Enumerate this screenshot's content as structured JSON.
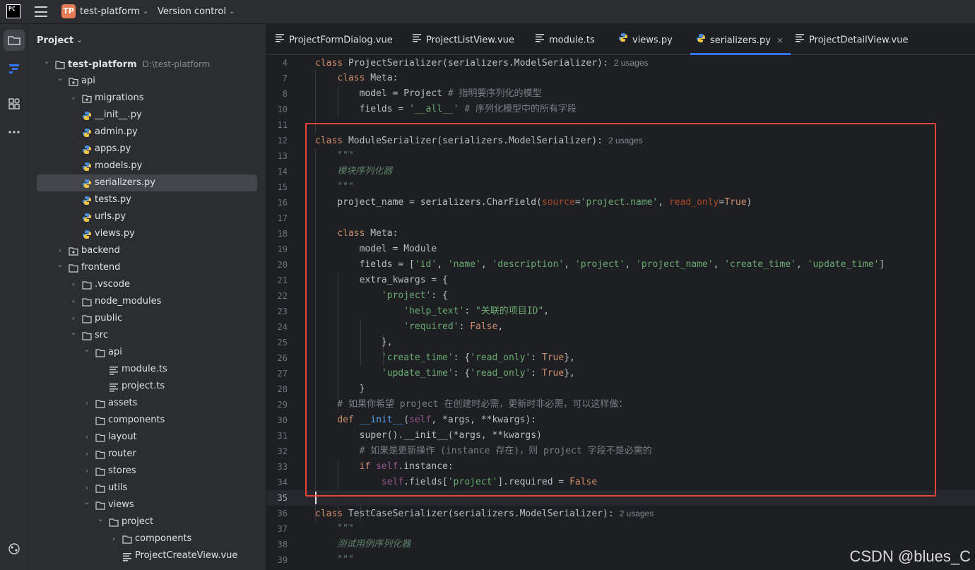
{
  "titlebar": {
    "logo_text": "PC",
    "project_badge": "TP",
    "project_name": "test-platform",
    "vcs_label": "Version control"
  },
  "toolstrip": {
    "icons": [
      "folder-icon",
      "structure-icon",
      "plugins-icon",
      "more-icon",
      "git-icon"
    ]
  },
  "project_panel": {
    "title": "Project",
    "tree": [
      {
        "label": "test-platform",
        "path": "D:\\test-platform",
        "depth": 0,
        "type": "folder",
        "expanded": true,
        "bold": true
      },
      {
        "label": "api",
        "depth": 1,
        "type": "package",
        "expanded": true
      },
      {
        "label": "migrations",
        "depth": 2,
        "type": "package",
        "expanded": false
      },
      {
        "label": "__init__.py",
        "depth": 2,
        "type": "python"
      },
      {
        "label": "admin.py",
        "depth": 2,
        "type": "python"
      },
      {
        "label": "apps.py",
        "depth": 2,
        "type": "python"
      },
      {
        "label": "models.py",
        "depth": 2,
        "type": "python"
      },
      {
        "label": "serializers.py",
        "depth": 2,
        "type": "python",
        "selected": true
      },
      {
        "label": "tests.py",
        "depth": 2,
        "type": "python"
      },
      {
        "label": "urls.py",
        "depth": 2,
        "type": "python"
      },
      {
        "label": "views.py",
        "depth": 2,
        "type": "python"
      },
      {
        "label": "backend",
        "depth": 1,
        "type": "package",
        "expanded": false
      },
      {
        "label": "frontend",
        "depth": 1,
        "type": "folder",
        "expanded": true
      },
      {
        "label": ".vscode",
        "depth": 2,
        "type": "folder",
        "expanded": false
      },
      {
        "label": "node_modules",
        "depth": 2,
        "type": "folder",
        "expanded": false
      },
      {
        "label": "public",
        "depth": 2,
        "type": "folder",
        "expanded": false
      },
      {
        "label": "src",
        "depth": 2,
        "type": "folder",
        "expanded": true
      },
      {
        "label": "api",
        "depth": 3,
        "type": "folder",
        "expanded": true
      },
      {
        "label": "module.ts",
        "depth": 4,
        "type": "text"
      },
      {
        "label": "project.ts",
        "depth": 4,
        "type": "text"
      },
      {
        "label": "assets",
        "depth": 3,
        "type": "folder",
        "expanded": false
      },
      {
        "label": "components",
        "depth": 3,
        "type": "folder",
        "leaf": true
      },
      {
        "label": "layout",
        "depth": 3,
        "type": "folder",
        "expanded": false
      },
      {
        "label": "router",
        "depth": 3,
        "type": "folder",
        "expanded": false
      },
      {
        "label": "stores",
        "depth": 3,
        "type": "folder",
        "expanded": false
      },
      {
        "label": "utils",
        "depth": 3,
        "type": "folder",
        "expanded": false
      },
      {
        "label": "views",
        "depth": 3,
        "type": "folder",
        "expanded": true
      },
      {
        "label": "project",
        "depth": 4,
        "type": "folder",
        "expanded": true
      },
      {
        "label": "components",
        "depth": 5,
        "type": "folder",
        "expanded": false
      },
      {
        "label": "ProjectCreateView.vue",
        "depth": 5,
        "type": "text"
      }
    ]
  },
  "tabs": [
    {
      "label": "ProjectFormDialog.vue",
      "type": "text"
    },
    {
      "label": "ProjectListView.vue",
      "type": "text"
    },
    {
      "label": "module.ts",
      "type": "text"
    },
    {
      "label": "views.py",
      "type": "python"
    },
    {
      "label": "serializers.py",
      "type": "python",
      "active": true,
      "close": "×"
    },
    {
      "label": "ProjectDetailView.vue",
      "type": "text"
    }
  ],
  "code": {
    "current_line": "35",
    "lines": [
      {
        "n": "4",
        "tokens": [
          [
            "kw",
            "class "
          ],
          [
            "",
            "ProjectSerializer(serializers.ModelSerializer):"
          ]
        ],
        "usage": "2 usages"
      },
      {
        "n": "7",
        "tokens": [
          [
            "",
            "    "
          ],
          [
            "kw",
            "class "
          ],
          [
            "",
            "Meta:"
          ]
        ]
      },
      {
        "n": "8",
        "tokens": [
          [
            "",
            "        model = Project "
          ],
          [
            "cm",
            "# 指明要序列化的模型"
          ]
        ]
      },
      {
        "n": "10",
        "tokens": [
          [
            "",
            "        fields = "
          ],
          [
            "str",
            "'__all__'"
          ],
          [
            "cm",
            " # 序列化模型中的所有字段"
          ]
        ]
      },
      {
        "n": "11",
        "tokens": []
      },
      {
        "n": "12",
        "tokens": [
          [
            "kw",
            "class "
          ],
          [
            "",
            "ModuleSerializer(serializers.ModelSerializer):"
          ]
        ],
        "usage": "2 usages"
      },
      {
        "n": "13",
        "tokens": [
          [
            "doc",
            "    \"\"\""
          ]
        ]
      },
      {
        "n": "14",
        "tokens": [
          [
            "docit",
            "    模块序列化器"
          ]
        ]
      },
      {
        "n": "15",
        "tokens": [
          [
            "doc",
            "    \"\"\""
          ]
        ]
      },
      {
        "n": "16",
        "tokens": [
          [
            "",
            "    project_name = serializers.CharField("
          ],
          [
            "prm",
            "source"
          ],
          [
            "",
            "="
          ],
          [
            "str",
            "'project.name'"
          ],
          [
            "",
            ", "
          ],
          [
            "prm",
            "read_only"
          ],
          [
            "",
            "="
          ],
          [
            "kw",
            "True"
          ],
          [
            "",
            ")"
          ]
        ]
      },
      {
        "n": "17",
        "tokens": []
      },
      {
        "n": "18",
        "tokens": [
          [
            "",
            "    "
          ],
          [
            "kw",
            "class "
          ],
          [
            "",
            "Meta:"
          ]
        ]
      },
      {
        "n": "19",
        "tokens": [
          [
            "",
            "        model = Module"
          ]
        ]
      },
      {
        "n": "20",
        "tokens": [
          [
            "",
            "        fields = ["
          ],
          [
            "str",
            "'id'"
          ],
          [
            "",
            ", "
          ],
          [
            "str",
            "'name'"
          ],
          [
            "",
            ", "
          ],
          [
            "str",
            "'description'"
          ],
          [
            "",
            ", "
          ],
          [
            "str",
            "'project'"
          ],
          [
            "",
            ", "
          ],
          [
            "str",
            "'project_name'"
          ],
          [
            "",
            ", "
          ],
          [
            "str",
            "'create_time'"
          ],
          [
            "",
            ", "
          ],
          [
            "str",
            "'update_time'"
          ],
          [
            "",
            "]"
          ]
        ]
      },
      {
        "n": "21",
        "tokens": [
          [
            "",
            "        extra_kwargs = {"
          ]
        ]
      },
      {
        "n": "22",
        "tokens": [
          [
            "",
            "            "
          ],
          [
            "str",
            "'project'"
          ],
          [
            "",
            ": {"
          ]
        ]
      },
      {
        "n": "23",
        "tokens": [
          [
            "",
            "                "
          ],
          [
            "str",
            "'help_text'"
          ],
          [
            "",
            ": "
          ],
          [
            "str",
            "\"关联的项目ID\""
          ],
          [
            "",
            ","
          ]
        ]
      },
      {
        "n": "24",
        "tokens": [
          [
            "",
            "                "
          ],
          [
            "str",
            "'required'"
          ],
          [
            "",
            ": "
          ],
          [
            "kw",
            "False"
          ],
          [
            "",
            ","
          ]
        ]
      },
      {
        "n": "25",
        "tokens": [
          [
            "",
            "            },"
          ]
        ]
      },
      {
        "n": "26",
        "tokens": [
          [
            "",
            "            "
          ],
          [
            "str",
            "'create_time'"
          ],
          [
            "",
            ": {"
          ],
          [
            "str",
            "'read_only'"
          ],
          [
            "",
            ": "
          ],
          [
            "kw",
            "True"
          ],
          [
            "",
            "},"
          ]
        ]
      },
      {
        "n": "27",
        "tokens": [
          [
            "",
            "            "
          ],
          [
            "str",
            "'update_time'"
          ],
          [
            "",
            ": {"
          ],
          [
            "str",
            "'read_only'"
          ],
          [
            "",
            ": "
          ],
          [
            "kw",
            "True"
          ],
          [
            "",
            "},"
          ]
        ]
      },
      {
        "n": "28",
        "tokens": [
          [
            "",
            "        }"
          ]
        ]
      },
      {
        "n": "29",
        "tokens": [
          [
            "cm",
            "    # 如果你希望 project 在创建时必需，更新时非必需，可以这样做："
          ]
        ]
      },
      {
        "n": "30",
        "tokens": [
          [
            "",
            "    "
          ],
          [
            "kw",
            "def "
          ],
          [
            "fn",
            "__init__"
          ],
          [
            "",
            "("
          ],
          [
            "self",
            "self"
          ],
          [
            "",
            ", *args, **kwargs):"
          ]
        ]
      },
      {
        "n": "31",
        "tokens": [
          [
            "",
            "        super().__init__(*args, **kwargs)"
          ]
        ]
      },
      {
        "n": "32",
        "tokens": [
          [
            "cm",
            "        # 如果是更新操作 (instance 存在)，则 project 字段不是必需的"
          ]
        ]
      },
      {
        "n": "33",
        "tokens": [
          [
            "",
            "        "
          ],
          [
            "kw",
            "if "
          ],
          [
            "self",
            "self"
          ],
          [
            "",
            ".instance:"
          ]
        ]
      },
      {
        "n": "34",
        "tokens": [
          [
            "",
            "            "
          ],
          [
            "self",
            "self"
          ],
          [
            "",
            ".fields["
          ],
          [
            "str",
            "'project'"
          ],
          [
            "",
            "].required = "
          ],
          [
            "kw",
            "False"
          ]
        ]
      },
      {
        "n": "35",
        "tokens": []
      },
      {
        "n": "36",
        "tokens": [
          [
            "kw",
            "class "
          ],
          [
            "",
            "TestCaseSerializer(serializers.ModelSerializer):"
          ]
        ],
        "usage": "2 usages"
      },
      {
        "n": "37",
        "tokens": [
          [
            "doc",
            "    \"\"\""
          ]
        ]
      },
      {
        "n": "38",
        "tokens": [
          [
            "docit",
            "    测试用例序列化器"
          ]
        ]
      },
      {
        "n": "39",
        "tokens": [
          [
            "doc",
            "    \"\"\""
          ]
        ]
      }
    ]
  },
  "colors": {
    "highlight_box": "#e5443a",
    "active_tab_underline": "#3574f0",
    "keyword": "#cf8e6d",
    "string": "#6aab73",
    "comment": "#7a7e85"
  },
  "watermark": "CSDN @blues_C"
}
